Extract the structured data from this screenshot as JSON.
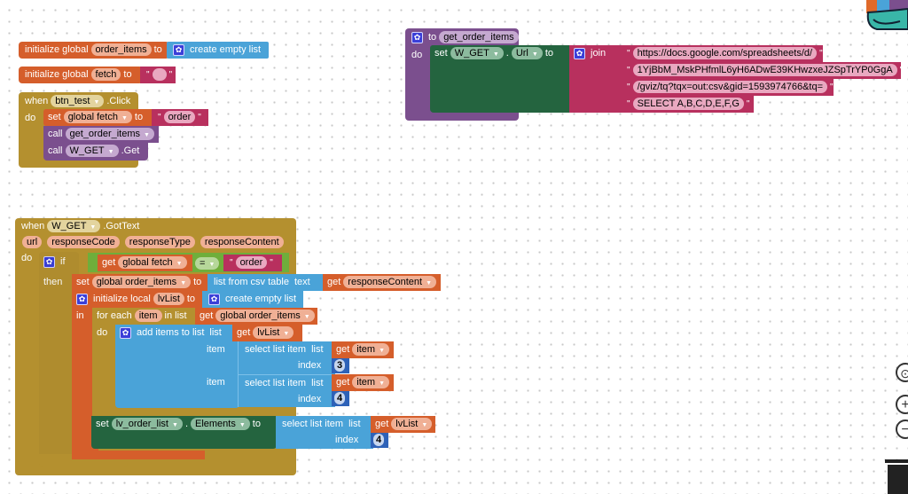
{
  "globals": [
    {
      "kw": "initialize global",
      "name": "order_items",
      "to": "to",
      "value_block": "create empty list"
    },
    {
      "kw": "initialize global",
      "name": "fetch",
      "to": "to",
      "value_block": ""
    }
  ],
  "btn_click": {
    "when": "when",
    "component": "btn_test",
    "event": ".Click",
    "do": "do",
    "set_kw": "set",
    "set_var": "global fetch",
    "set_to": "to",
    "set_value": "order",
    "call1_kw": "call",
    "call1_proc": "get_order_items",
    "call2_kw": "call",
    "call2_comp": "W_GET",
    "call2_method": ".Get"
  },
  "proc": {
    "to": "to",
    "name": "get_order_items",
    "do": "do",
    "set_kw": "set",
    "component": "W_GET",
    "dot": ".",
    "property": "Url",
    "set_to": "to",
    "join": "join",
    "strings": [
      "https://docs.google.com/spreadsheets/d/",
      "1YjBbM_MskPHfmlL6yH6ADwE39KHwzxeJZSpTrYP0GgA",
      "/gviz/tq?tqx=out:csv&gid=1593974766&tq=",
      "SELECT A,B,C,D,E,F,G"
    ]
  },
  "gottext": {
    "when": "when",
    "component": "W_GET",
    "event": ".GotText",
    "params": [
      "url",
      "responseCode",
      "responseType",
      "responseContent"
    ],
    "do": "do",
    "if": "if",
    "then": "then",
    "cond_get": "get",
    "cond_var": "global fetch",
    "cond_op": "=",
    "cond_value": "order",
    "set_kw": "set",
    "set_var": "global order_items",
    "set_to": "to",
    "csv_label": "list from csv table",
    "csv_text": "text",
    "csv_get": "get",
    "csv_var": "responseContent",
    "local_kw": "initialize local",
    "local_name": "lvList",
    "local_to": "to",
    "local_value": "create empty list",
    "in": "in",
    "foreach_kw": "for each",
    "foreach_var": "item",
    "foreach_in": "in list",
    "foreach_get": "get",
    "foreach_list": "global order_items",
    "foreach_do": "do",
    "add_label": "add items to list",
    "add_list": "list",
    "add_get": "get",
    "add_list_var": "lvList",
    "items": [
      {
        "item": "item",
        "select": "select list item",
        "list": "list",
        "get": "get",
        "var": "item",
        "index_label": "index",
        "index": "3"
      },
      {
        "item": "item",
        "select": "select list item",
        "list": "list",
        "get": "get",
        "var": "item",
        "index_label": "index",
        "index": "4"
      }
    ],
    "set2_kw": "set",
    "set2_comp": "lv_order_list",
    "set2_dot": ".",
    "set2_prop": "Elements",
    "set2_to": "to",
    "set2_select": "select list item",
    "set2_list": "list",
    "set2_get": "get",
    "set2_var": "lvList",
    "set2_index_label": "index",
    "set2_index": "4"
  },
  "controls": {
    "recenter": "⊙",
    "zoom_in": "+",
    "zoom_out": "−"
  }
}
